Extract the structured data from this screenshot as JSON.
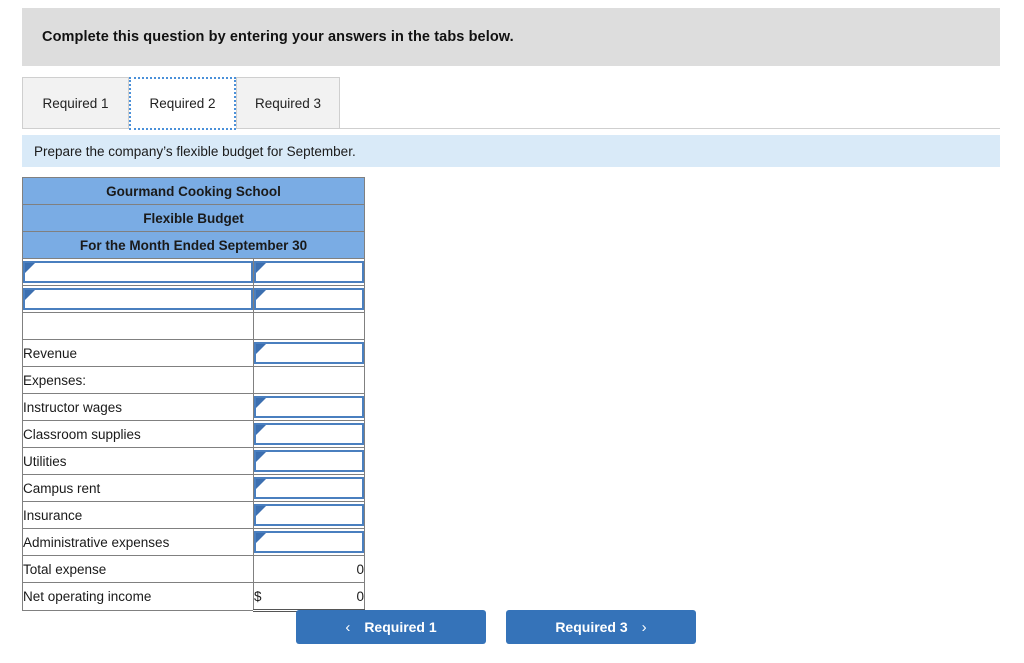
{
  "banner": {
    "text": "Complete this question by entering your answers in the tabs below."
  },
  "tabs": [
    {
      "label": "Required 1",
      "active": false
    },
    {
      "label": "Required 2",
      "active": true
    },
    {
      "label": "Required 3",
      "active": false
    }
  ],
  "prompt": {
    "text": "Prepare the company’s flexible budget for September."
  },
  "table": {
    "headers": [
      "Gourmand Cooking School",
      "Flexible Budget",
      "For the Month Ended September 30"
    ],
    "rows": [
      {
        "label": "",
        "indent": false,
        "label_input": true,
        "value_kind": "input",
        "value": ""
      },
      {
        "label": "",
        "indent": false,
        "label_input": true,
        "value_kind": "input",
        "value": ""
      },
      {
        "label": "",
        "indent": false,
        "label_input": false,
        "value_kind": "blank",
        "value": ""
      },
      {
        "label": "Revenue",
        "indent": false,
        "label_input": false,
        "value_kind": "input",
        "value": ""
      },
      {
        "label": "Expenses:",
        "indent": false,
        "label_input": false,
        "value_kind": "blank",
        "value": ""
      },
      {
        "label": "Instructor wages",
        "indent": true,
        "label_input": false,
        "value_kind": "input",
        "value": ""
      },
      {
        "label": "Classroom supplies",
        "indent": true,
        "label_input": false,
        "value_kind": "input",
        "value": ""
      },
      {
        "label": "Utilities",
        "indent": true,
        "label_input": false,
        "value_kind": "input",
        "value": ""
      },
      {
        "label": "Campus rent",
        "indent": true,
        "label_input": false,
        "value_kind": "input",
        "value": ""
      },
      {
        "label": "Insurance",
        "indent": true,
        "label_input": false,
        "value_kind": "input",
        "value": ""
      },
      {
        "label": "Administrative expenses",
        "indent": true,
        "label_input": false,
        "value_kind": "input",
        "value": ""
      },
      {
        "label": "Total expense",
        "indent": false,
        "label_input": false,
        "value_kind": "number",
        "value": "0"
      },
      {
        "label": "Net operating income",
        "indent": false,
        "label_input": false,
        "value_kind": "money",
        "currency": "$",
        "value": "0"
      }
    ]
  },
  "nav": {
    "prev_label": "Required 1",
    "prev_icon": "chevron-left-icon",
    "next_label": "Required 3",
    "next_icon": "chevron-right-icon"
  },
  "colors": {
    "banner_gray": "#dddddd",
    "prompt_blue": "#d9eaf8",
    "header_blue": "#7aace4",
    "button_blue": "#3573b9",
    "input_border": "#4a7fbf",
    "tab_focus": "#4a90d9"
  }
}
